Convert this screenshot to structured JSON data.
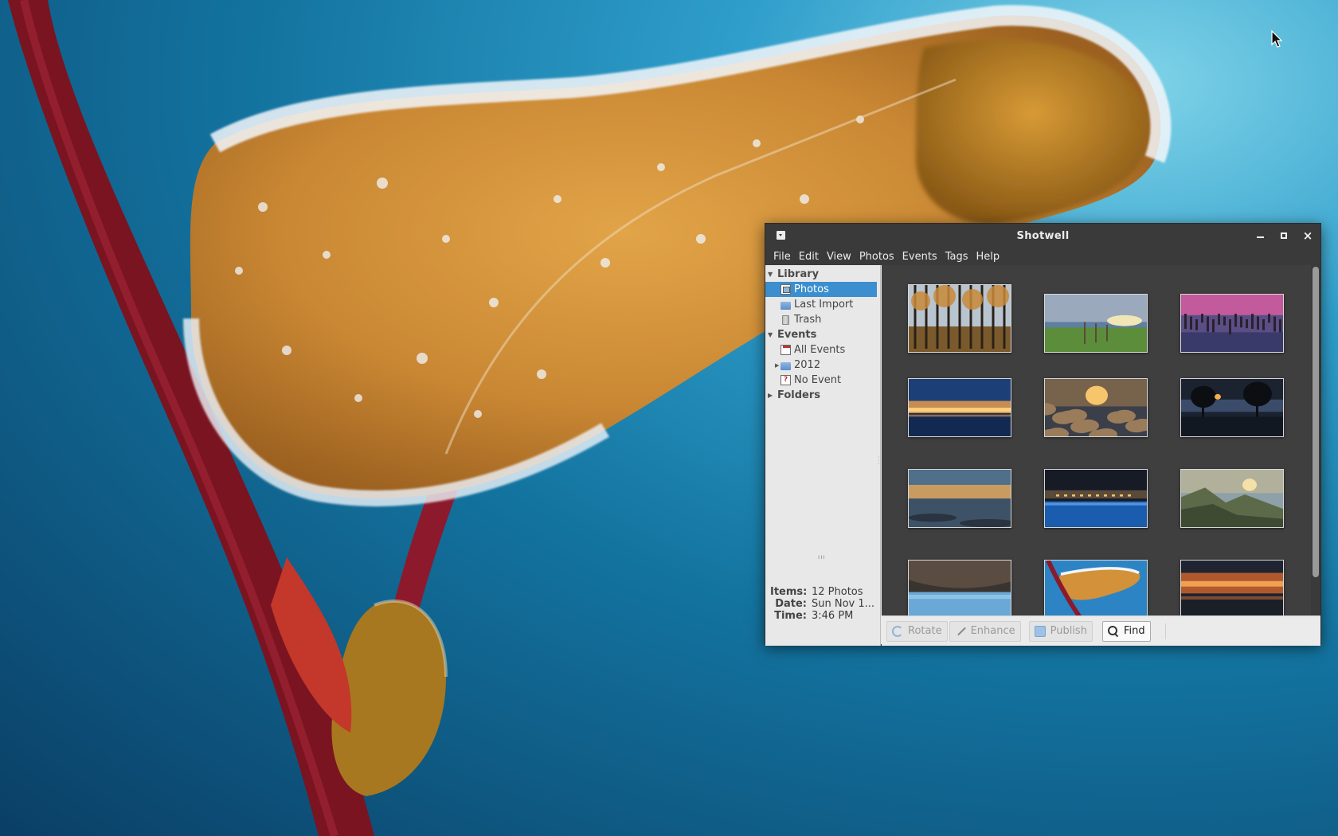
{
  "window": {
    "title": "Shotwell",
    "controls": {
      "minimize": "minimize",
      "maximize": "maximize",
      "close": "×"
    }
  },
  "menubar": [
    "File",
    "Edit",
    "View",
    "Photos",
    "Events",
    "Tags",
    "Help"
  ],
  "sidebar": {
    "library": {
      "label": "Library",
      "items": [
        {
          "label": "Photos",
          "icon": "photos-icon",
          "selected": true
        },
        {
          "label": "Last Import",
          "icon": "folder-icon"
        },
        {
          "label": "Trash",
          "icon": "trash-icon"
        }
      ]
    },
    "events": {
      "label": "Events",
      "items": [
        {
          "label": "All Events",
          "icon": "events-icon"
        },
        {
          "label": "2012",
          "icon": "folder-icon",
          "expandable": true
        },
        {
          "label": "No Event",
          "icon": "no-event-icon"
        }
      ]
    },
    "folders": {
      "label": "Folders"
    }
  },
  "properties": {
    "items_label": "Items:",
    "items_value": "12 Photos",
    "date_label": "Date:",
    "date_value": "Sun Nov 1...",
    "time_label": "Time:",
    "time_value": "3:46 PM"
  },
  "toolbar": {
    "rotate": "Rotate",
    "enhance": "Enhance",
    "publish": "Publish",
    "find": "Find"
  },
  "colors": {
    "selection": "#3c8fcf",
    "viewer_bg": "#3f3f3f",
    "titlebar": "#3a3a3a"
  },
  "thumbnails": [
    {
      "name": "forest-autumn",
      "kind": "forest"
    },
    {
      "name": "fence-meadow",
      "kind": "meadow"
    },
    {
      "name": "pier-posts-pink",
      "kind": "pier"
    },
    {
      "name": "blue-sunset-lake",
      "kind": "bluesunset"
    },
    {
      "name": "rocks-sunburst",
      "kind": "rocks"
    },
    {
      "name": "dusk-trees",
      "kind": "dusktrees"
    },
    {
      "name": "sea-sunset",
      "kind": "seasunset"
    },
    {
      "name": "resort-night",
      "kind": "resort"
    },
    {
      "name": "mountain-sunrise",
      "kind": "mountain"
    },
    {
      "name": "lava-cave",
      "kind": "cave"
    },
    {
      "name": "frosted-leaf",
      "kind": "leaf"
    },
    {
      "name": "orange-clouds",
      "kind": "clouds"
    }
  ]
}
